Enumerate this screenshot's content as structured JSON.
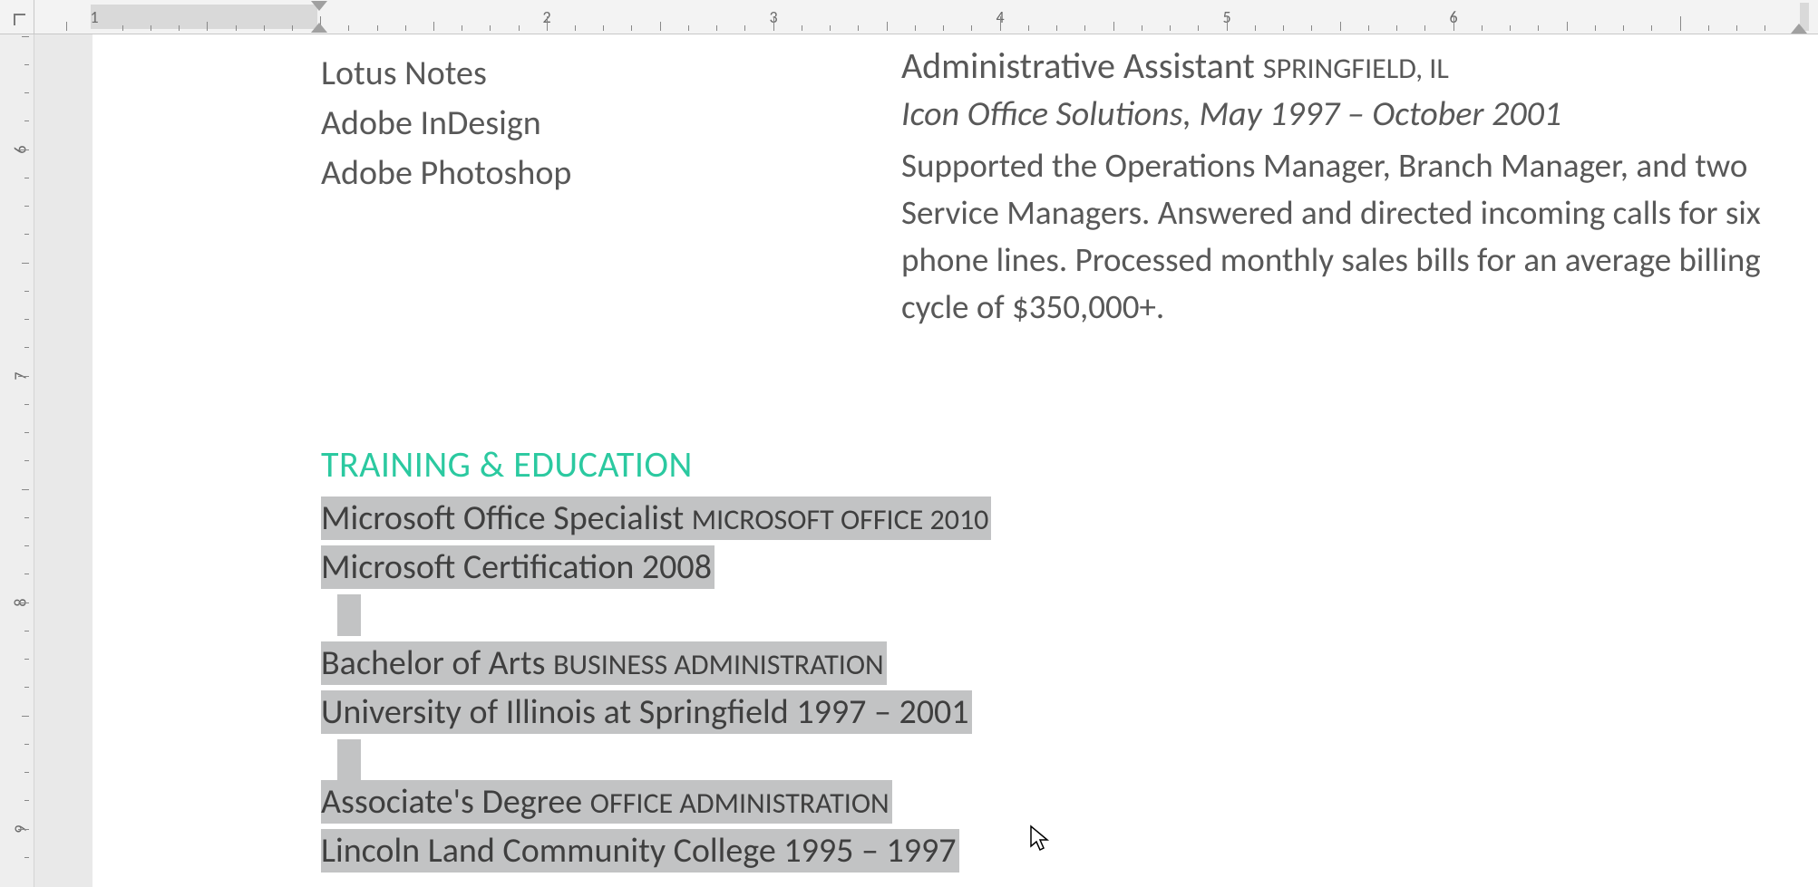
{
  "ruler": {
    "h_numbers": [
      "1",
      "2",
      "3",
      "4",
      "5",
      "6"
    ],
    "v_numbers": [
      "6",
      "7",
      "8",
      "9"
    ]
  },
  "skills": {
    "items": [
      "Lotus Notes",
      "Adobe InDesign",
      "Adobe Photoshop"
    ]
  },
  "job": {
    "title": "Administrative Assistant",
    "location_caps": "SPRINGFIELD, IL",
    "subline": "Icon Office Solutions, May 1997 – October 2001",
    "description": "Supported the Operations Manager, Branch Manager, and two Service Managers. Answered and directed incoming calls for six phone lines. Processed monthly sales bills for an average billing cycle of $350,000+."
  },
  "section_heading": "TRAINING & EDUCATION",
  "edu": {
    "e1": {
      "line1_a": "Microsoft Office Specialist ",
      "line1_b_caps": "MICROSOFT OFFICE 2010",
      "line2": "Microsoft Certification 2008"
    },
    "e2": {
      "line1_a": "Bachelor of Arts ",
      "line1_b_caps": "BUSINESS ADMINISTRATION",
      "line2": "University of Illinois at Springfield 1997 – 2001"
    },
    "e3": {
      "line1_a": "Associate's Degree ",
      "line1_b_caps": "OFFICE ADMINISTRATION",
      "line2": "Lincoln Land Community College 1995 – 1997"
    }
  }
}
